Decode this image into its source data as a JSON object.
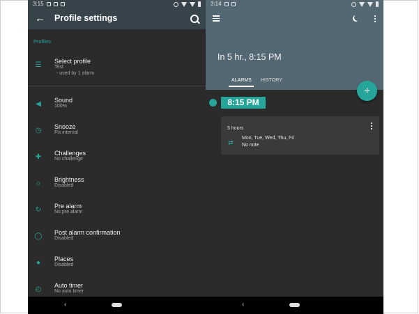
{
  "left": {
    "statusbar": {
      "time": "3:15"
    },
    "appbar": {
      "title": "Profile settings"
    },
    "section_header": "Profiles",
    "settings": [
      {
        "title": "Select profile",
        "subtitle": "Test",
        "subtitle2": "- used by 1 alarm",
        "icon": "tune-icon"
      },
      {
        "title": "Sound",
        "subtitle": "100%",
        "icon": "volume-icon"
      },
      {
        "title": "Snooze",
        "subtitle": "Fix interval",
        "icon": "snooze-icon"
      },
      {
        "title": "Challenges",
        "subtitle": "No challenge",
        "icon": "puzzle-icon"
      },
      {
        "title": "Brightness",
        "subtitle": "Disabled",
        "icon": "brightness-icon"
      },
      {
        "title": "Pre alarm",
        "subtitle": "No pre alarm",
        "icon": "history-icon"
      },
      {
        "title": "Post alarm confirmation",
        "subtitle": "Disabled",
        "icon": "shield-icon"
      },
      {
        "title": "Places",
        "subtitle": "Disabled",
        "icon": "place-icon"
      },
      {
        "title": "Auto timer",
        "subtitle": "No auto timer",
        "icon": "timer-icon"
      }
    ]
  },
  "right": {
    "statusbar": {
      "time": "3:14"
    },
    "next_alarm": "In 5 hr., 8:15 PM",
    "tabs": [
      "ALARMS",
      "HISTORY"
    ],
    "fab_label": "+",
    "alarm": {
      "time": "8:15 PM",
      "relative": "5 hours",
      "days": "Mon, Tue, Wed, Thu, Fri",
      "note": "No note"
    }
  },
  "colors": {
    "accent": "#26a69a",
    "toolbar": "#37444b",
    "header": "#546873",
    "background": "#2b2b2b"
  }
}
